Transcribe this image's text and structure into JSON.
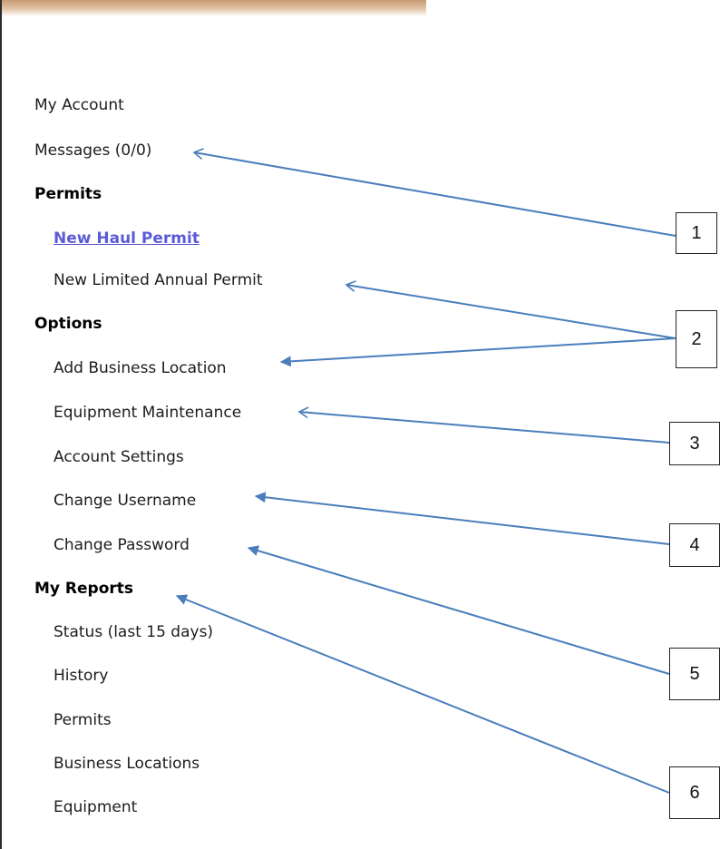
{
  "nav": {
    "my_account": "My Account",
    "messages": "Messages (0/0)",
    "permits_header": "Permits",
    "new_haul_permit": "New Haul Permit",
    "new_limited_annual_permit": "New Limited Annual Permit",
    "options_header": "Options",
    "add_business_location": "Add Business Location",
    "equipment_maintenance": "Equipment Maintenance",
    "account_settings": "Account Settings",
    "change_username": "Change Username",
    "change_password": "Change Password",
    "my_reports_header": "My Reports",
    "status_last_15_days": "Status (last 15 days)",
    "history": "History",
    "permits": "Permits",
    "business_locations": "Business Locations",
    "equipment": "Equipment"
  },
  "callouts": [
    "1",
    "2",
    "3",
    "4",
    "5",
    "6"
  ],
  "colors": {
    "arrow": "#4a7ebb",
    "link": "#5b5bd6",
    "header_strip": "#c89a72"
  }
}
